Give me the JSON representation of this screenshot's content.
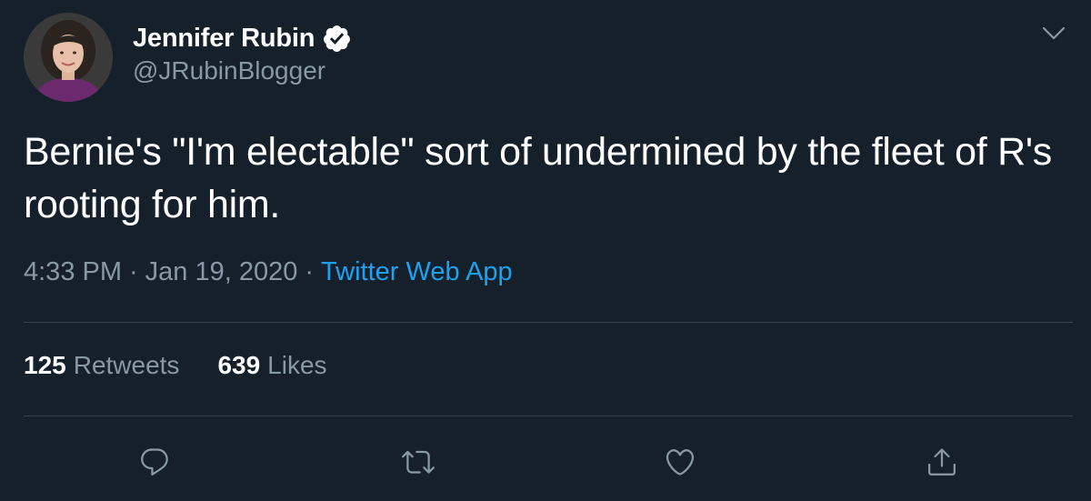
{
  "author": {
    "display_name": "Jennifer Rubin",
    "handle": "@JRubinBlogger",
    "verified": true
  },
  "tweet": {
    "text": "Bernie's \"I'm electable\" sort of undermined by the fleet of R's rooting for him."
  },
  "meta": {
    "time": "4:33 PM",
    "separator": "·",
    "date": "Jan 19, 2020",
    "source": "Twitter Web App"
  },
  "stats": {
    "retweets_count": "125",
    "retweets_label": "Retweets",
    "likes_count": "639",
    "likes_label": "Likes"
  },
  "actions": {
    "reply_icon": "reply-icon",
    "retweet_icon": "retweet-icon",
    "like_icon": "heart-icon",
    "share_icon": "share-icon"
  },
  "colors": {
    "background": "#15202b",
    "primary_text": "#ffffff",
    "secondary_text": "#8899a6",
    "accent": "#1da1f2",
    "divider": "#38444d"
  }
}
